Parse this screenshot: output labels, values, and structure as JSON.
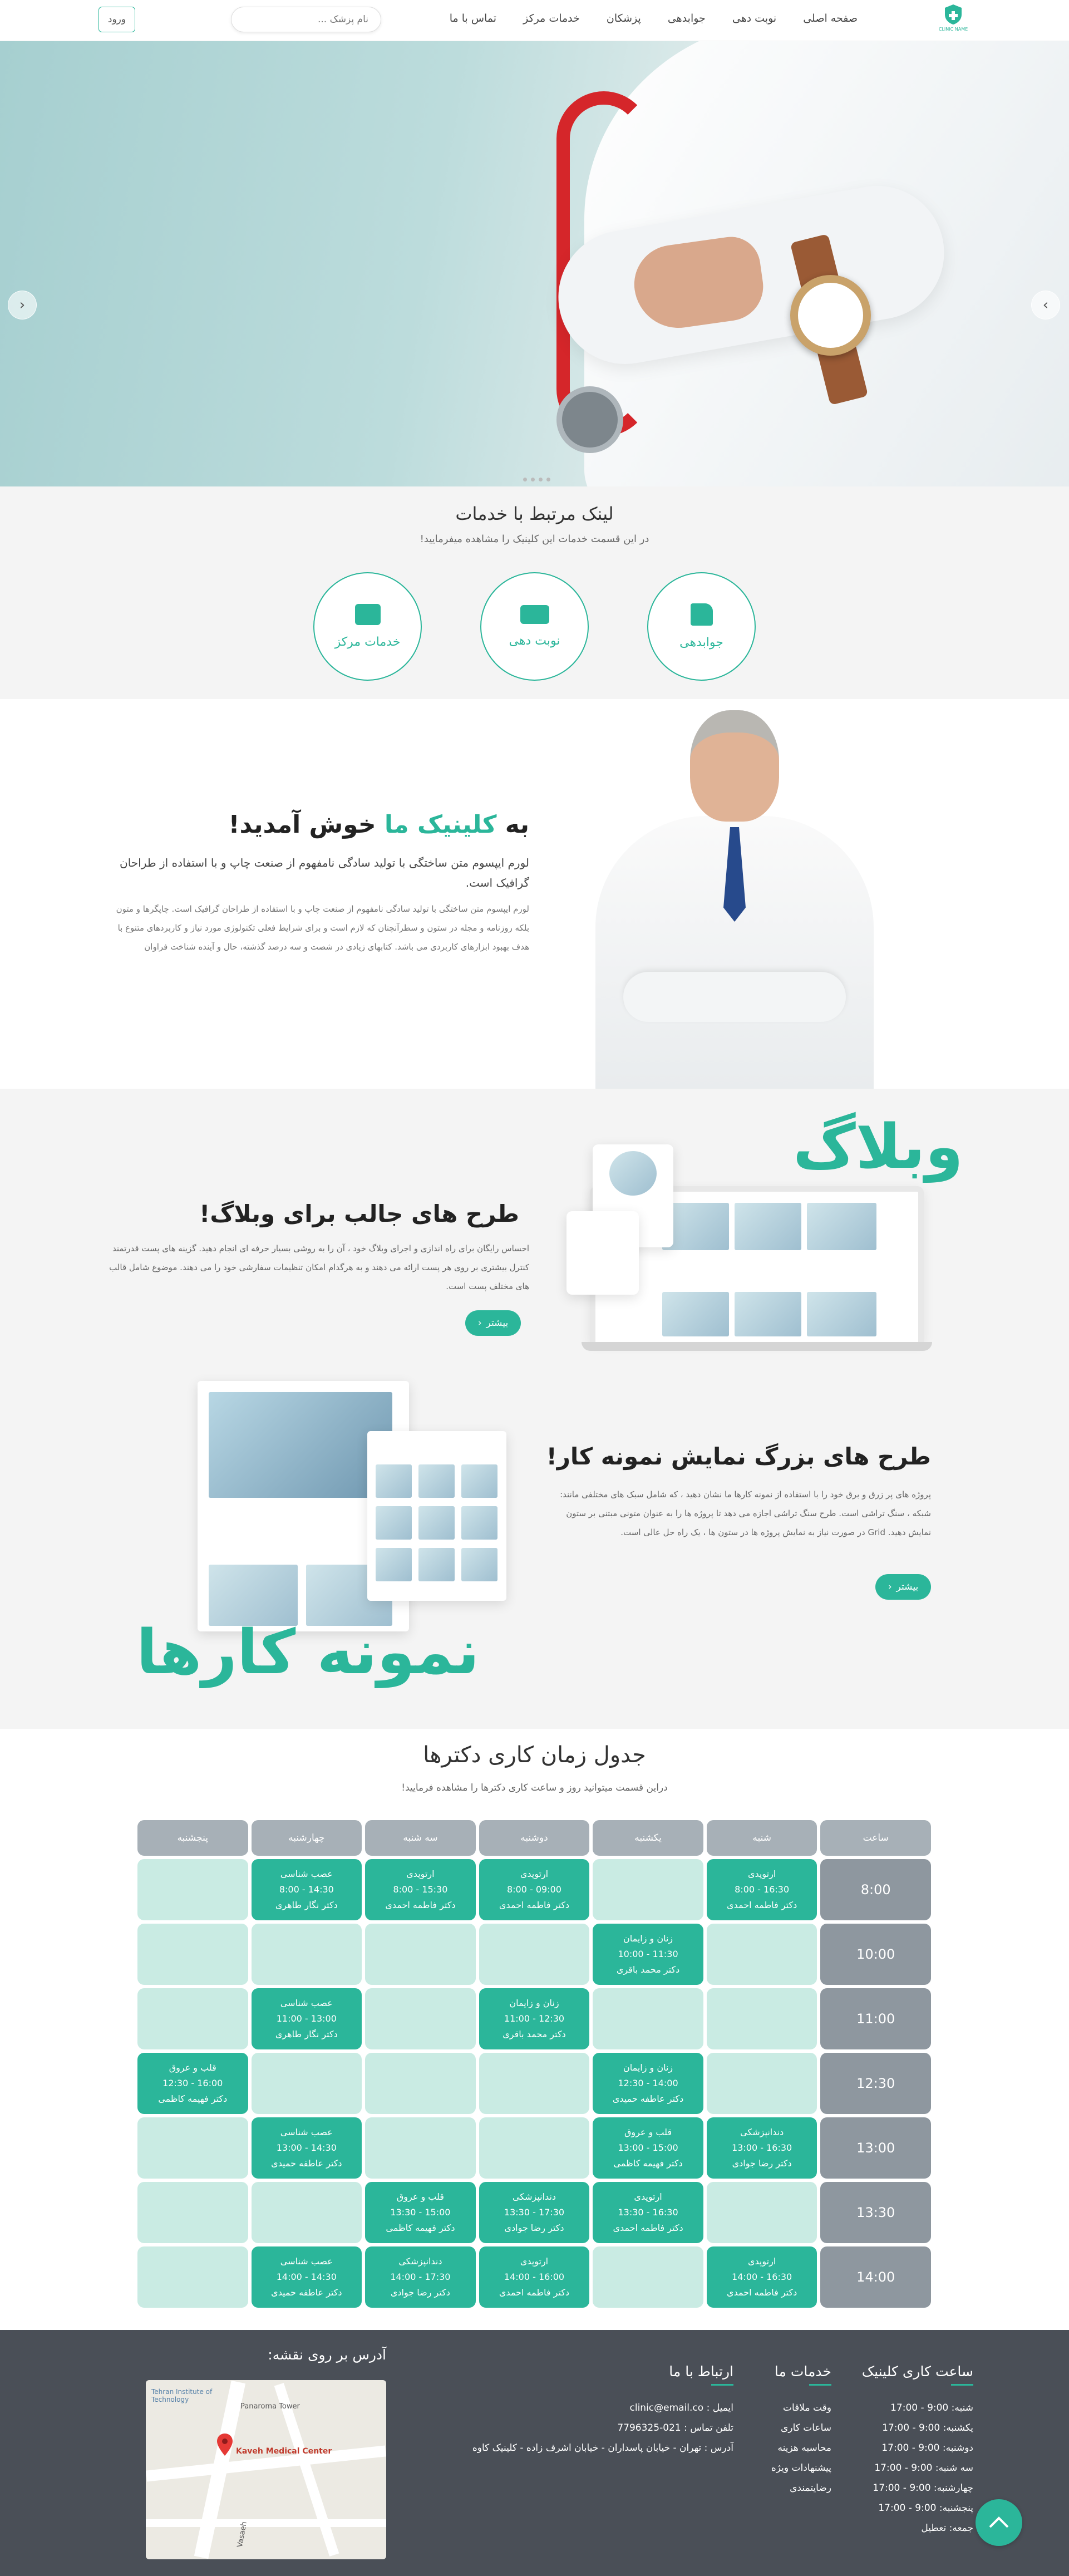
{
  "header": {
    "logo_text": "CLINIC NAME",
    "nav": [
      "صفحه اصلی",
      "نوبت دهی",
      "جوابدهی",
      "پزشکان",
      "خدمات مرکز",
      "تماس با ما"
    ],
    "search_placeholder": "نام پزشک ...",
    "login_label": "ورود"
  },
  "hero": {
    "prev_icon": "chevron-left-icon",
    "next_icon": "chevron-right-icon"
  },
  "services": {
    "title": "لینک مرتبط با خدمات",
    "subtitle": "در این قسمت خدمات این کلینیک را مشاهده میفرمایید!",
    "items": [
      {
        "label": "جوابدهی",
        "icon": "file-icon"
      },
      {
        "label": "نوبت دهی",
        "icon": "ticket-icon"
      },
      {
        "label": "خدمات مرکز",
        "icon": "medical-bag-icon"
      }
    ]
  },
  "welcome": {
    "title_pre": "به ",
    "title_highlight": "کلینیک ما",
    "title_post": " خوش آمدید!",
    "lead": "لورم ایپسوم متن ساختگی با تولید سادگی نامفهوم از صنعت چاپ و با استفاده از طراحان گرافیک است.",
    "body": "لورم ایپسوم متن ساختگی با تولید سادگی نامفهوم از صنعت چاپ و با استفاده از طراحان گرافیک است. چاپگرها و متون بلکه روزنامه و مجله در ستون و سطرآنچنان که لازم است و برای شرایط فعلی تکنولوژی مورد نیاز و کاربردهای متنوع با هدف بهبود ابزارهای کاربردی می باشد. کتابهای زیادی در شصت و سه درصد گذشته، حال و آینده شناخت فراوان"
  },
  "blog": {
    "big_word": "وبلاگ",
    "title": "طرح های جالب برای وبلاگ!",
    "body": "احساس رایگان برای راه اندازی و اجرای وبلاگ خود ، آن را به روشی بسیار حرفه ای انجام دهید. گزینه های پست قدرتمند کنترل بیشتری بر روی هر پست ارائه می دهند و به هرگدام امکان تنظیمات سفارشی خود را می دهند. موضوع شامل قالب های مختلف پست است.",
    "more": "بیشتر"
  },
  "portfolio": {
    "big_word": "نمونه کارها",
    "title": "طرح های بزرگ نمایش نمونه کار!",
    "body": "پروژه های پر زرق و برق خود را با استفاده از نمونه کارها ما نشان دهید ، که شامل سبک های مختلفی مانند: شبکه ، سنگ تراشی است. طرح سنگ تراشی اجازه می دهد تا پروژه ها را به عنوان متونی مبتنی بر ستون نمایش دهید. Grid در صورت نیاز به نمایش پروژه ها در ستون ها ، یک راه حل عالی است.",
    "more": "بیشتر"
  },
  "schedule": {
    "title": "جدول زمان کاری دکترها",
    "subtitle": "دراین قسمت میتوانید روز و ساعت کاری دکترها را مشاهده فرمایید!",
    "headers": [
      "ساعت",
      "شنبه",
      "یکشنبه",
      "دوشنبه",
      "سه شنبه",
      "چهارشنبه",
      "پنجشنبه"
    ],
    "rows": [
      {
        "time": "8:00",
        "cells": [
          {
            "s": "ارتوپدی",
            "t": "16:30 - 8:00",
            "d": "دکتر فاطمه احمدی"
          },
          null,
          {
            "s": "ارتوپدی",
            "t": "09:00 - 8:00",
            "d": "دکتر فاطمه احمدی"
          },
          {
            "s": "ارتوپدی",
            "t": "15:30 - 8:00",
            "d": "دکتر فاطمه احمدی"
          },
          {
            "s": "عصب شناسی",
            "t": "14:30 - 8:00",
            "d": "دکتر نگار طاهری"
          },
          null
        ]
      },
      {
        "time": "10:00",
        "cells": [
          null,
          {
            "s": "زنان و زایمان",
            "t": "11:30 - 10:00",
            "d": "دکتر محمد باقری"
          },
          null,
          null,
          null,
          null
        ]
      },
      {
        "time": "11:00",
        "cells": [
          null,
          null,
          {
            "s": "زنان و زایمان",
            "t": "12:30 - 11:00",
            "d": "دکتر محمد باقری"
          },
          null,
          {
            "s": "عصب شناسی",
            "t": "13:00 - 11:00",
            "d": "دکتر نگار طاهری"
          },
          null
        ]
      },
      {
        "time": "12:30",
        "cells": [
          null,
          {
            "s": "زنان و زایمان",
            "t": "14:00 - 12:30",
            "d": "دکتر عاطفه حمیدی"
          },
          null,
          null,
          null,
          {
            "s": "قلب و عروق",
            "t": "16:00 - 12:30",
            "d": "دکتر فهیمه کاظمی"
          }
        ]
      },
      {
        "time": "13:00",
        "cells": [
          {
            "s": "دندانپزشکی",
            "t": "16:30 - 13:00",
            "d": "دکتر رضا جوادی"
          },
          {
            "s": "قلب و عروق",
            "t": "15:00 - 13:00",
            "d": "دکتر فهیمه کاظمی"
          },
          null,
          null,
          {
            "s": "عصب شناسی",
            "t": "14:30 - 13:00",
            "d": "دکتر عاطفه حمیدی"
          },
          null
        ]
      },
      {
        "time": "13:30",
        "cells": [
          null,
          {
            "s": "ارتوپدی",
            "t": "16:30 - 13:30",
            "d": "دکتر فاطمه احمدی"
          },
          {
            "s": "دندانپزشکی",
            "t": "17:30 - 13:30",
            "d": "دکتر رضا جوادی"
          },
          {
            "s": "قلب و عروق",
            "t": "15:00 - 13:30",
            "d": "دکتر فهیمه کاظمی"
          },
          null,
          null
        ]
      },
      {
        "time": "14:00",
        "cells": [
          {
            "s": "ارتوپدی",
            "t": "16:30 - 14:00",
            "d": "دکتر فاطمه احمدی"
          },
          null,
          {
            "s": "ارتوپدی",
            "t": "16:00 - 14:00",
            "d": "دکتر فاطمه احمدی"
          },
          {
            "s": "دندانپزشکی",
            "t": "17:30 - 14:00",
            "d": "دکتر رضا جوادی"
          },
          {
            "s": "عصب شناسی",
            "t": "14:30 - 14:00",
            "d": "دکتر عاطفه حمیدی"
          },
          null
        ]
      }
    ]
  },
  "footer": {
    "hours_title": "ساعت کاری کلینیک",
    "hours": [
      "شنبه: 9:00 - 17:00",
      "یکشنبه: 9:00 - 17:00",
      "دوشنبه: 9:00 - 17:00",
      "سه شنبه: 9:00 - 17:00",
      "چهارشنبه: 9:00 - 17:00",
      "پنجشنبه: 9:00 - 17:00",
      "جمعه: تعطیل"
    ],
    "services_title": "خدمات ما",
    "services": [
      "وقت ملاقات",
      "ساعات کاری",
      "محاسبه هزینه",
      "پیشنهادات ویژه",
      "رضایتمندی"
    ],
    "contact_title": "ارتباط با ما",
    "contact": [
      "ایمیل : clinic@email.co",
      "تلفن تماس : 021-7796325",
      "آدرس : تهران - خیابان پاسداران - خیابان اشرف زاده - کلینیک کاوه"
    ],
    "map_title": "آدرس بر روی نقشه:",
    "map_labels": [
      "Tehran Institute of Technology",
      "Panaroma Tower",
      "Kaveh Medical Center",
      "Vasaeh"
    ]
  },
  "colors": {
    "accent": "#2bb69a",
    "footer_bg": "#4a4f57",
    "cell_empty": "#c9ebe3",
    "time_cell": "#8e979f",
    "header_cell": "#a7b0b7"
  }
}
